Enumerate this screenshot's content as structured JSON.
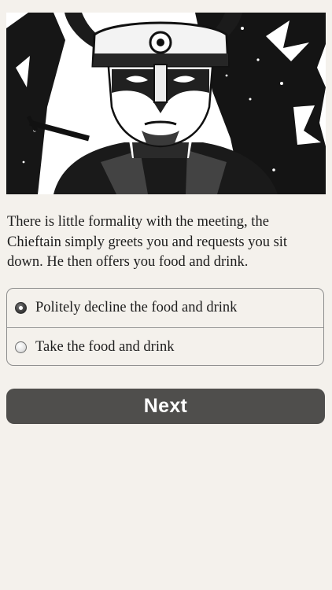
{
  "story": {
    "text": "There is little formality with the meeting, the Chieftain simply greets you and requests you sit down. He then offers you food and drink."
  },
  "choices": [
    {
      "label": "Politely decline the food and drink",
      "selected": true
    },
    {
      "label": "Take the food and drink",
      "selected": false
    }
  ],
  "actions": {
    "next_label": "Next"
  }
}
